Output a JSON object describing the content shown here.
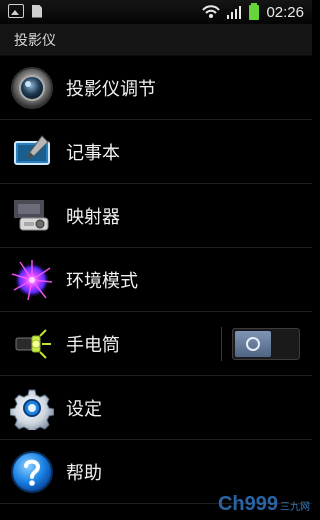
{
  "status_bar": {
    "time": "02:26",
    "icons": [
      "picture-icon",
      "document-icon",
      "wifi-icon",
      "signal-icon",
      "battery-icon"
    ]
  },
  "header": {
    "title": "投影仪"
  },
  "menu": {
    "items": [
      {
        "label": "投影仪调节",
        "icon": "projector-lens-icon"
      },
      {
        "label": "记事本",
        "icon": "notepad-icon"
      },
      {
        "label": "映射器",
        "icon": "projector-device-icon"
      },
      {
        "label": "环境模式",
        "icon": "ambient-burst-icon"
      },
      {
        "label": "手电筒",
        "icon": "flashlight-icon",
        "toggle": {
          "state": "off"
        }
      },
      {
        "label": "设定",
        "icon": "gear-icon"
      },
      {
        "label": "帮助",
        "icon": "help-icon"
      }
    ]
  },
  "watermark": {
    "big": "Ch999",
    "small": "三九网"
  },
  "colors": {
    "background": "#000000",
    "text": "#f0f0f0",
    "header_bg": "#141414",
    "switch_knob": "#6f86a6",
    "help_blue": "#1c84e6"
  }
}
